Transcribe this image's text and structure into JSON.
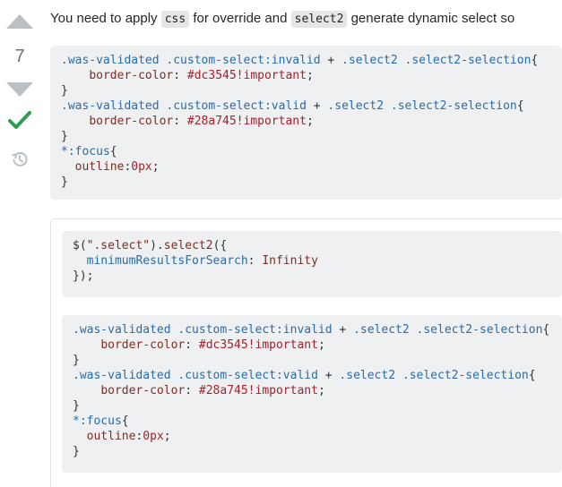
{
  "vote": {
    "count": "7",
    "up_icon": "arrow-up-icon",
    "down_icon": "arrow-down-icon",
    "accepted_icon": "checkmark-icon",
    "history_icon": "history-icon",
    "accepted_color": "#2f9e4f"
  },
  "answer": {
    "text_part1": "You need to apply ",
    "code_css": "css",
    "text_part2": " for override and ",
    "code_select2": "select2",
    "text_part3": " generate dynamic select so"
  },
  "block1": {
    "l1_sel1": ".was-validated .custom-select:invalid",
    "l1_op": " + ",
    "l1_sel2": ".select2 .select2-selection",
    "l1_brace": "{",
    "l2_prop": "border-color",
    "l2_val": "#dc3545!important",
    "l3": "}",
    "l4_sel1": ".was-validated .custom-select:valid",
    "l4_op": " + ",
    "l4_sel2": ".select2 .select2-selection",
    "l4_brace": "{",
    "l5_prop": "border-color",
    "l5_val": "#28a745!important",
    "l6": "}",
    "l7_sel": "*:focus",
    "l7_brace": "{",
    "l8_prop": "outline",
    "l8_val": "0px",
    "l9": "}"
  },
  "snippet_js": {
    "l1_a": "$(",
    "l1_str": "\".select\"",
    "l1_b": ").",
    "l1_fn": "select2",
    "l1_c": "({",
    "l2_key": "minimumResultsForSearch",
    "l2_val": "Infinity",
    "l3": "});"
  },
  "snippet_css": {
    "l1_sel1": ".was-validated .custom-select:invalid",
    "l1_op": " + ",
    "l1_sel2": ".select2 .select2-selection",
    "l1_brace": "{",
    "l2_prop": "border-color",
    "l2_val": "#dc3545!important",
    "l3": "}",
    "l4_sel1": ".was-validated .custom-select:valid",
    "l4_op": " + ",
    "l4_sel2": ".select2 .select2-selection",
    "l4_brace": "{",
    "l5_prop": "border-color",
    "l5_val": "#28a745!important",
    "l6": "}",
    "l7_sel": "*:focus",
    "l7_brace": "{",
    "l8_prop": "outline",
    "l8_val": "0px",
    "l9": "}"
  }
}
